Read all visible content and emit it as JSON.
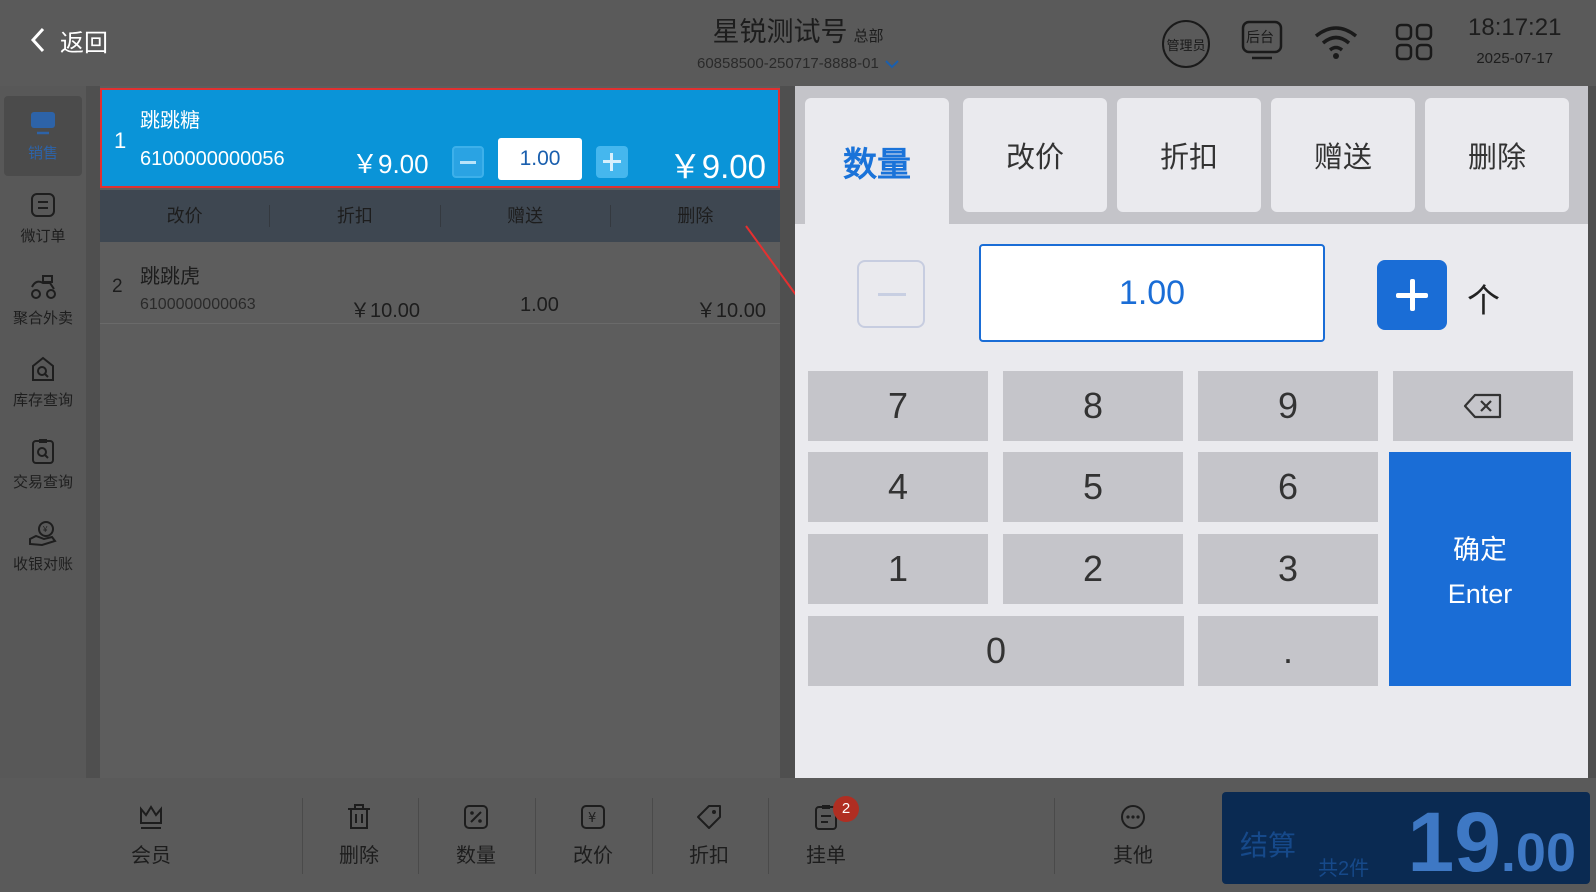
{
  "header": {
    "back_label": "返回",
    "store_name": "星锐测试号",
    "store_tag": "总部",
    "order_code": "60858500-250717-8888-01",
    "manager_label": "管理员",
    "backend_label": "后台",
    "time": "18:17:21",
    "date": "2025-07-17"
  },
  "sidebar": {
    "items": [
      {
        "label": "销售",
        "icon": "sales-icon"
      },
      {
        "label": "微订单",
        "icon": "micro-order-icon"
      },
      {
        "label": "聚合外卖",
        "icon": "delivery-icon"
      },
      {
        "label": "库存查询",
        "icon": "inventory-icon"
      },
      {
        "label": "交易查询",
        "icon": "transaction-icon"
      },
      {
        "label": "收银对账",
        "icon": "reconcile-icon"
      }
    ]
  },
  "orders": {
    "selected": {
      "index": "1",
      "name": "跳跳糖",
      "sku": "6100000000056",
      "price": "￥9.00",
      "qty": "1.00",
      "total": "￥9.00"
    },
    "row_actions": [
      "改价",
      "折扣",
      "赠送",
      "删除"
    ],
    "items": [
      {
        "index": "2",
        "name": "跳跳虎",
        "sku": "6100000000063",
        "price": "￥10.00",
        "qty": "1.00",
        "total": "￥10.00"
      }
    ]
  },
  "panel": {
    "tabs": [
      "数量",
      "改价",
      "折扣",
      "赠送",
      "删除"
    ],
    "active_tab": "数量",
    "qty_value": "1.00",
    "unit": "个",
    "keys": [
      "7",
      "8",
      "9",
      "4",
      "5",
      "6",
      "1",
      "2",
      "3",
      "0",
      "."
    ],
    "enter_line1": "确定",
    "enter_line2": "Enter"
  },
  "bottom": {
    "items": [
      {
        "label": "会员",
        "icon": "member-icon"
      },
      {
        "label": "删除",
        "icon": "trash-icon"
      },
      {
        "label": "数量",
        "icon": "quantity-icon"
      },
      {
        "label": "改价",
        "icon": "price-change-icon"
      },
      {
        "label": "折扣",
        "icon": "discount-tag-icon"
      },
      {
        "label": "挂单",
        "icon": "hold-order-icon"
      },
      {
        "label": "其他",
        "icon": "more-icon"
      }
    ],
    "hold_badge": "2",
    "checkout_label": "结算",
    "checkout_count": "共2件",
    "checkout_amount_int": "19",
    "checkout_amount_dec": ".00"
  },
  "colors": {
    "accent": "#1a6dd6",
    "selected_row": "#0a94d8",
    "highlight_border": "#e03030",
    "checkout_bg": "#0a2a52"
  }
}
